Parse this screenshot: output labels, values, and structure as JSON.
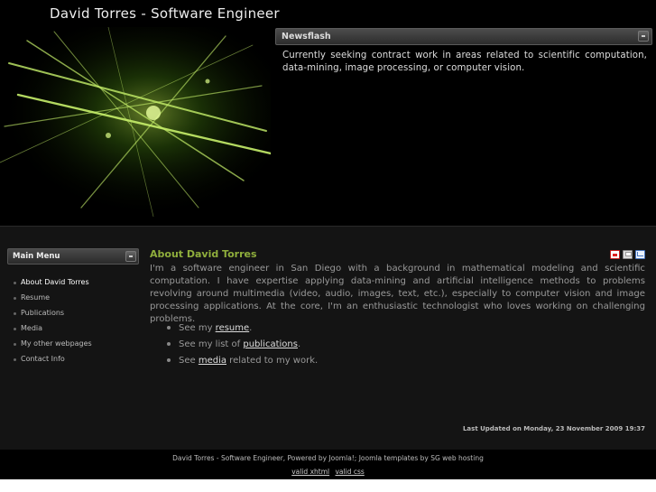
{
  "header": {
    "site_title": "David Torres - Software Engineer"
  },
  "newsflash": {
    "title": "Newsflash",
    "text": "Currently seeking contract work in areas related to scientific computation, data-mining,  image processing, or computer vision."
  },
  "main_menu": {
    "title": "Main Menu",
    "items": [
      {
        "label": "About David Torres"
      },
      {
        "label": "Resume"
      },
      {
        "label": "Publications"
      },
      {
        "label": "Media"
      },
      {
        "label": "My other webpages"
      },
      {
        "label": "Contact Info"
      }
    ]
  },
  "article": {
    "title": "About David Torres",
    "body": "I'm a software engineer in San Diego with a background in mathematical modeling and scientific computation. I have expertise applying data-mining and artificial intelligence methods to problems revolving around multimedia (video,  audio, images, text, etc.), especially to computer vision and image processing applications.  At the core, I'm an enthusiastic technologist who loves working on challenging problems.",
    "links": [
      {
        "prefix": "See my ",
        "link": "resume",
        "suffix": "."
      },
      {
        "prefix": "See my list of ",
        "link": "publications",
        "suffix": "."
      },
      {
        "prefix": "See ",
        "link": "media",
        "suffix": " related to my work."
      }
    ],
    "icons": [
      "pdf-icon",
      "print-icon",
      "email-icon"
    ],
    "last_updated": "Last Updated on Monday, 23 November 2009 19:37"
  },
  "footer": {
    "text": "David Torres - Software Engineer, Powered by Joomla!; Joomla templates by SG web hosting",
    "links": [
      "valid xhtml",
      "valid css"
    ]
  }
}
